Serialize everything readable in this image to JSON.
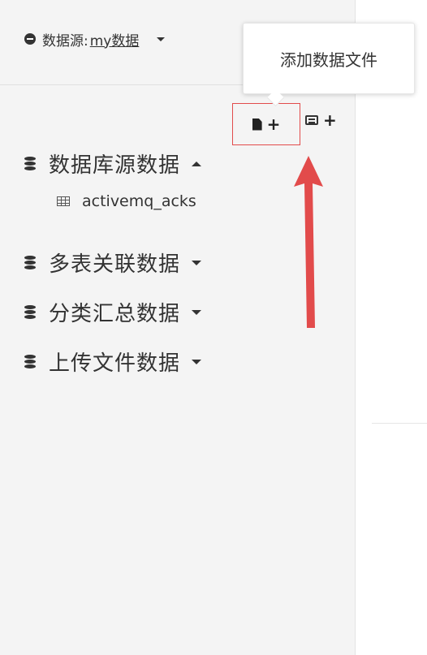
{
  "header": {
    "datasource_label": "数据源:",
    "datasource_value": "my数据"
  },
  "tooltip": {
    "text": "添加数据文件"
  },
  "sections": [
    {
      "label": "数据库源数据",
      "expanded": true,
      "items": [
        {
          "label": "activemq_acks"
        }
      ]
    },
    {
      "label": "多表关联数据",
      "expanded": false
    },
    {
      "label": "分类汇总数据",
      "expanded": false
    },
    {
      "label": "上传文件数据",
      "expanded": false
    }
  ],
  "toolbar": {
    "add_file_symbol": "+",
    "add_table_symbol": "+"
  },
  "colors": {
    "accent_red": "#e24b4b",
    "sidebar_bg": "#f4f4f4"
  }
}
